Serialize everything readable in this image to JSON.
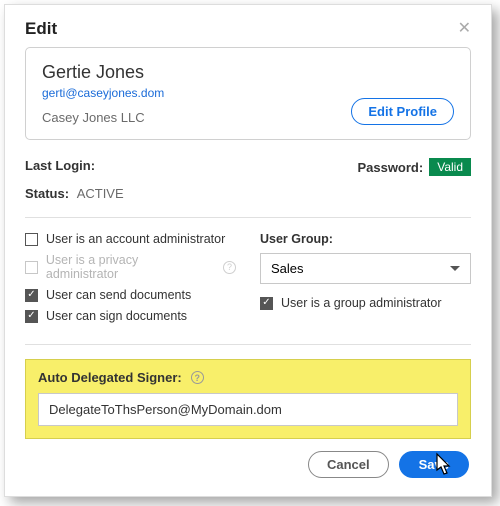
{
  "dialog": {
    "title": "Edit"
  },
  "user": {
    "name": "Gertie Jones",
    "email": "gerti@caseyjones.dom",
    "company": "Casey Jones LLC",
    "edit_profile_label": "Edit Profile"
  },
  "meta": {
    "last_login_label": "Last Login:",
    "last_login_value": "",
    "password_label": "Password:",
    "password_badge": "Valid",
    "status_label": "Status:",
    "status_value": "ACTIVE"
  },
  "perms": {
    "account_admin": "User is an account administrator",
    "privacy_admin": "User is a privacy administrator",
    "send_docs": "User can send documents",
    "sign_docs": "User can sign documents"
  },
  "group": {
    "label": "User Group:",
    "selected": "Sales",
    "group_admin": "User is a group administrator"
  },
  "delegate": {
    "label": "Auto Delegated Signer:",
    "value": "DelegateToThsPerson@MyDomain.dom"
  },
  "footer": {
    "cancel": "Cancel",
    "save": "Save"
  }
}
